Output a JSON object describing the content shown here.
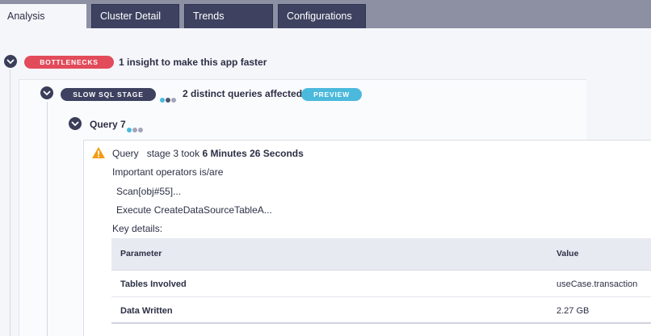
{
  "tabs": [
    {
      "label": "Analysis"
    },
    {
      "label": "Cluster Detail"
    },
    {
      "label": "Trends"
    },
    {
      "label": "Configurations"
    }
  ],
  "insight": {
    "badge": "BOTTLENECKS",
    "summary": "1 insight to make this app faster",
    "badge_color": "#e24b5a"
  },
  "stage": {
    "badge": "SLOW SQL STAGE",
    "summary": "2 distinct queries affected",
    "preview": "PREVIEW",
    "badge_color": "#3e4260",
    "preview_color": "#4bb9dc"
  },
  "query": {
    "title": "Query 7",
    "warning_icon": "warning-triangle-icon",
    "line_prefix": "Query",
    "line_stage": "stage 3 took",
    "duration": "6 Minutes 26 Seconds",
    "operators_label": "Important operators is/are",
    "operators": [
      "Scan[obj#55]...",
      "Execute CreateDataSourceTableA..."
    ],
    "key_details_label": "Key details:"
  },
  "details_table": {
    "headers": [
      "Parameter",
      "Value"
    ],
    "rows": [
      [
        "Tables Involved",
        "useCase.transaction"
      ],
      [
        "Data Written",
        "2.27 GB"
      ]
    ]
  },
  "colors": {
    "accent": "#4bb9dc",
    "warning": "#f39c12",
    "dark": "#3e4260"
  }
}
